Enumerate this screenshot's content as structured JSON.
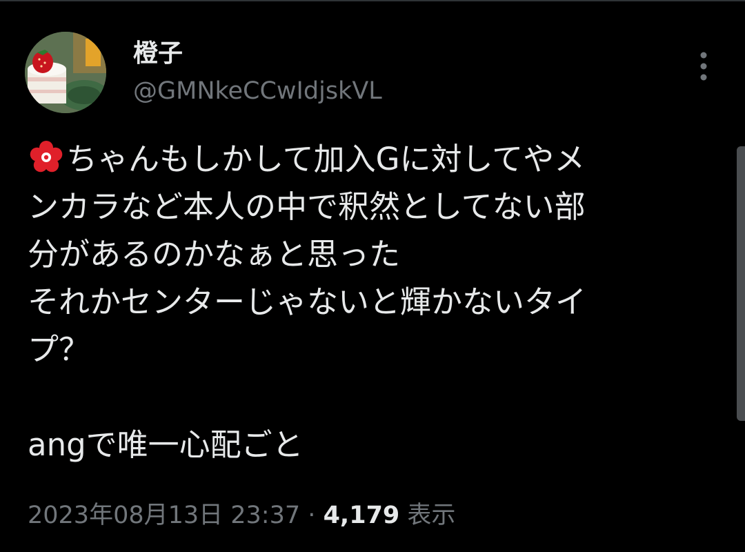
{
  "post": {
    "author": {
      "display_name": "橙子",
      "handle": "@GMNkeCCwIdjskVL"
    },
    "text_lines": [
      "ちゃんもしかして加入Gに対してやメ",
      "ンカラなど本人の中で釈然としてない部",
      "分があるのかなぁと思った",
      "それかセンターじゃないと輝かないタイ",
      "プ？",
      "angで唯一心配ごと"
    ],
    "emoji_icon": "red-flower-icon",
    "timestamp": "2023年08月13日 23:37",
    "separator": "·",
    "views_count": "4,179",
    "views_label": "表示"
  },
  "icons": {
    "more": "more-vertical-icon"
  },
  "colors": {
    "background": "#000000",
    "primary_text": "#e7e9ea",
    "secondary_text": "#71767b",
    "flower": "#e0202a"
  }
}
